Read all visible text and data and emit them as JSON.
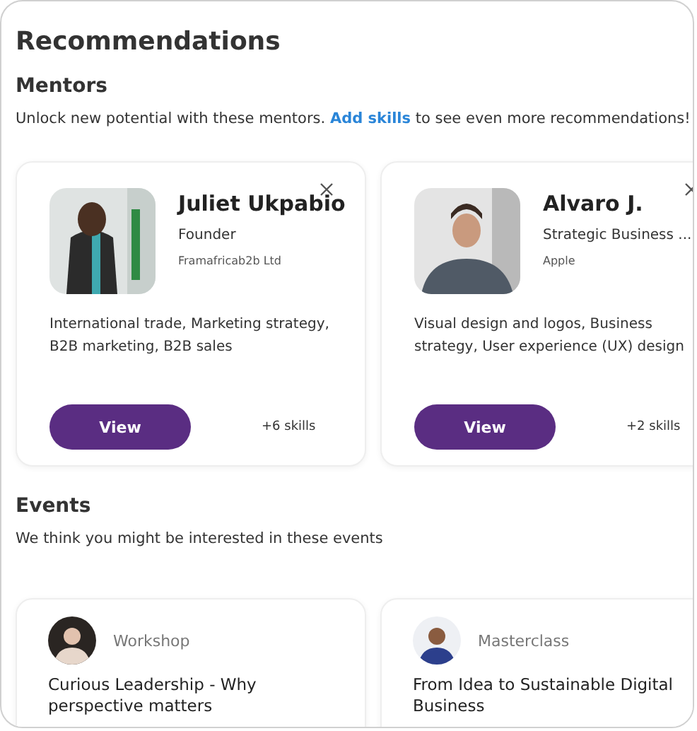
{
  "title": "Recommendations",
  "mentors": {
    "heading": "Mentors",
    "intro": "Unlock new potential with these mentors.",
    "link": "Add skills",
    "intro_rest": "to see even more recommendations!",
    "cards": [
      {
        "name": "Juliet Ukpabio",
        "role": "Founder",
        "company": "Framafricab2b Ltd",
        "skills": "International trade, Marketing strategy, B2B marketing, B2B sales",
        "button": "View",
        "more": "+6 skills"
      },
      {
        "name": "Alvaro J.",
        "role": "Strategic Business ...",
        "company": "Apple",
        "skills": "Visual design and logos, Business strategy, User experience (UX) design",
        "button": "View",
        "more": "+2 skills"
      }
    ]
  },
  "events": {
    "heading": "Events",
    "intro": "We think you might be interested in these events",
    "cards": [
      {
        "type": "Workshop",
        "title": "Curious Leadership - Why perspective matters"
      },
      {
        "type": "Masterclass",
        "title": "From Idea to Sustainable Digital Business"
      }
    ]
  }
}
